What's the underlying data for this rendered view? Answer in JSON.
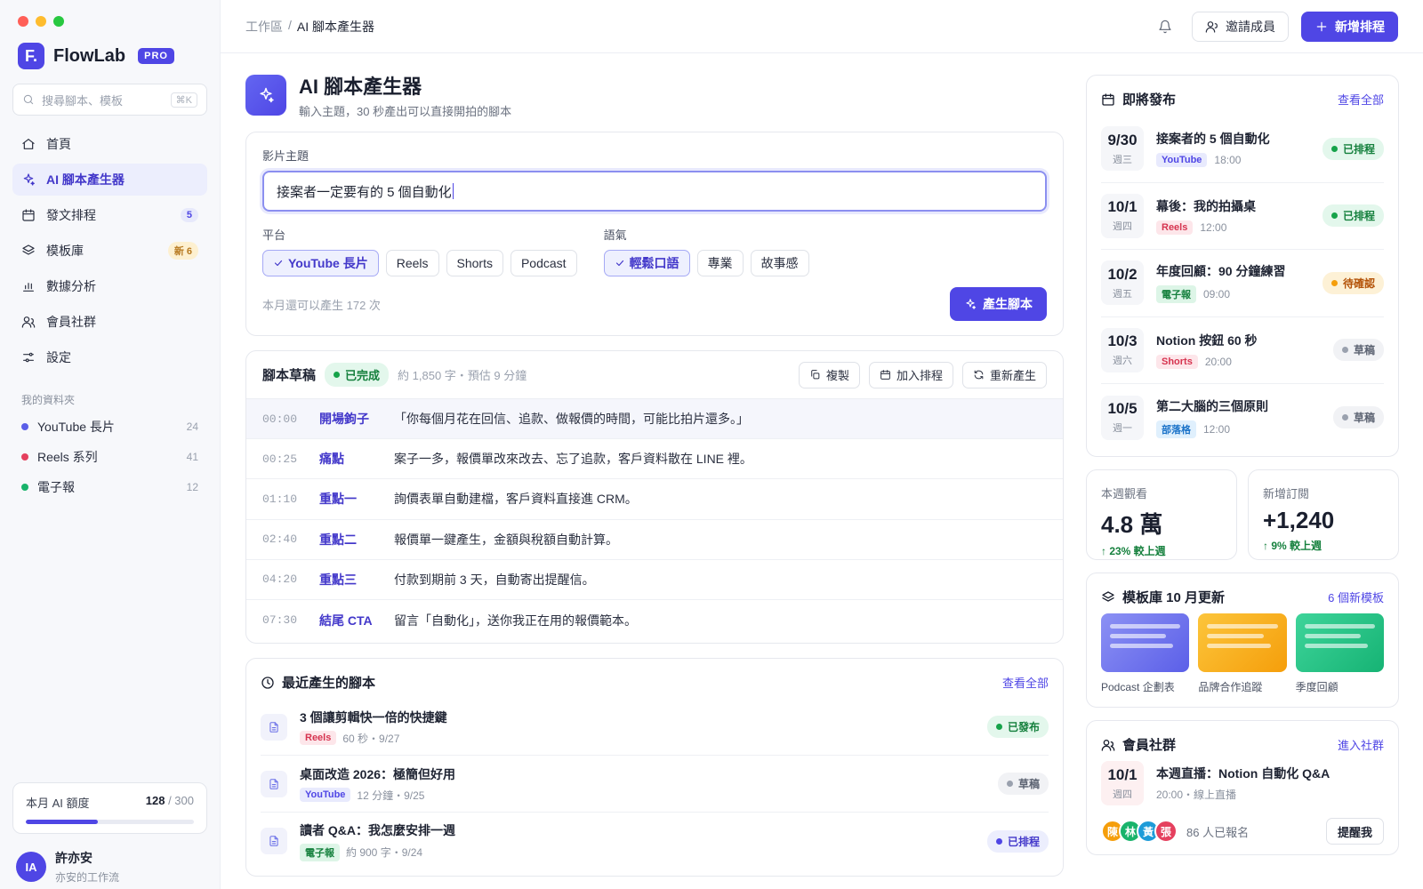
{
  "window": {
    "dots": [
      "#ff5f57",
      "#febc2e",
      "#28c840"
    ]
  },
  "brand": {
    "logo": "F.",
    "name": "FlowLab",
    "badge": "PRO"
  },
  "search": {
    "placeholder": "搜尋腳本、模板",
    "shortcut": "⌘K"
  },
  "nav": [
    {
      "label": "首頁",
      "icon": "home-icon"
    },
    {
      "label": "AI 腳本產生器",
      "icon": "sparkle-icon",
      "active": true
    },
    {
      "label": "發文排程",
      "icon": "calendar-icon",
      "count": "5"
    },
    {
      "label": "模板庫",
      "icon": "layers-icon",
      "badge": "新 6"
    },
    {
      "label": "數據分析",
      "icon": "chart-icon"
    },
    {
      "label": "會員社群",
      "icon": "users-icon"
    },
    {
      "label": "設定",
      "icon": "sliders-icon"
    }
  ],
  "folders": {
    "title": "我的資料夾",
    "items": [
      {
        "label": "YouTube 長片",
        "count": "24",
        "color": "#5b5fe8"
      },
      {
        "label": "Reels 系列",
        "count": "41",
        "color": "#e5405e"
      },
      {
        "label": "電子報",
        "count": "12",
        "color": "#19b36b"
      }
    ]
  },
  "quota": {
    "label": "本月 AI 額度",
    "used": "128",
    "total": "/ 300",
    "fraction": 0.427
  },
  "user": {
    "initials": "IA",
    "name": "許亦安",
    "subtitle": "亦安的工作流"
  },
  "topbar": {
    "crumb_root": "工作區",
    "crumb_sep": "/",
    "crumb_current": "AI 腳本產生器",
    "invite_label": "邀請成員",
    "new_label": "新增排程"
  },
  "page": {
    "title": "AI 腳本產生器",
    "subtitle": "輸入主題，30 秒產出可以直接開拍的腳本"
  },
  "generator": {
    "topic_label": "影片主題",
    "topic_value": "接案者一定要有的 5 個自動化",
    "platform_label": "平台",
    "platforms": [
      {
        "label": "YouTube 長片",
        "on": true
      },
      {
        "label": "Reels"
      },
      {
        "label": "Shorts"
      },
      {
        "label": "Podcast"
      }
    ],
    "tone_label": "語氣",
    "tones": [
      {
        "label": "輕鬆口語",
        "on": true
      },
      {
        "label": "專業"
      },
      {
        "label": "故事感"
      }
    ],
    "quota_note": "本月還可以產生 172 次",
    "generate_label": "產生腳本"
  },
  "draft": {
    "title": "腳本草稿",
    "status": "已完成",
    "meta": "約 1,850 字・預估 9 分鐘",
    "copy_label": "複製",
    "schedule_label": "加入排程",
    "regen_label": "重新產生",
    "lines": [
      {
        "time": "00:00",
        "section": "開場鉤子",
        "text": "「你每個月花在回信、追款、做報價的時間，可能比拍片還多。」"
      },
      {
        "time": "00:25",
        "section": "痛點",
        "text": "案子一多，報價單改來改去、忘了追款，客戶資料散在 LINE 裡。"
      },
      {
        "time": "01:10",
        "section": "重點一",
        "text": "詢價表單自動建檔，客戶資料直接進 CRM。"
      },
      {
        "time": "02:40",
        "section": "重點二",
        "text": "報價單一鍵產生，金額與稅額自動計算。"
      },
      {
        "time": "04:20",
        "section": "重點三",
        "text": "付款到期前 3 天，自動寄出提醒信。"
      },
      {
        "time": "07:30",
        "section": "結尾 CTA",
        "text": "留言「自動化」，送你我正在用的報價範本。"
      }
    ]
  },
  "recent": {
    "title": "最近產生的腳本",
    "link": "查看全部",
    "items": [
      {
        "title": "3 個讓剪輯快一倍的快捷鍵",
        "tag": "Reels",
        "tag_class": "reels",
        "meta": "60 秒・9/27",
        "status": "已發布",
        "status_class": "pub"
      },
      {
        "title": "桌面改造 2026：極簡但好用",
        "tag": "YouTube",
        "tag_class": "yt",
        "meta": "12 分鐘・9/25",
        "status": "草稿",
        "status_class": "draftp"
      },
      {
        "title": "讀者 Q&A：我怎麼安排一週",
        "tag": "電子報",
        "tag_class": "news",
        "meta": "約 900 字・9/24",
        "status": "已排程",
        "status_class": "sched"
      }
    ]
  },
  "upcoming": {
    "title": "即將發布",
    "link": "查看全部",
    "items": [
      {
        "date": "9/30",
        "weekday": "週三",
        "title": "接案者的 5 個自動化",
        "tag": "YouTube",
        "tag_class": "yt",
        "time": "18:00",
        "status": "已排程",
        "status_class": "pub"
      },
      {
        "date": "10/1",
        "weekday": "週四",
        "title": "幕後：我的拍攝桌",
        "tag": "Reels",
        "tag_class": "reels",
        "time": "12:00",
        "status": "已排程",
        "status_class": "pub"
      },
      {
        "date": "10/2",
        "weekday": "週五",
        "title": "年度回顧：90 分鐘練習",
        "tag": "電子報",
        "tag_class": "news",
        "time": "09:00",
        "status": "待確認",
        "status_class": "pend"
      },
      {
        "date": "10/3",
        "weekday": "週六",
        "title": "Notion 按鈕 60 秒",
        "tag": "Shorts",
        "tag_class": "shorts",
        "time": "20:00",
        "status": "草稿",
        "status_class": "draftp"
      },
      {
        "date": "10/5",
        "weekday": "週一",
        "title": "第二大腦的三個原則",
        "tag": "部落格",
        "tag_class": "blog",
        "time": "12:00",
        "status": "草稿",
        "status_class": "draftp"
      }
    ]
  },
  "stats": [
    {
      "label": "本週觀看",
      "value": "4.8 萬",
      "delta": "↑ 23% 較上週"
    },
    {
      "label": "新增訂閱",
      "value": "+1,240",
      "delta": "↑ 9% 較上週"
    }
  ],
  "templates": {
    "title": "模板庫 10 月更新",
    "link": "6 個新模板",
    "items": [
      {
        "name": "Podcast 企劃表",
        "from": "#8c91f4",
        "to": "#5b5fe8"
      },
      {
        "name": "品牌合作追蹤",
        "from": "#fcc53b",
        "to": "#f59e0b"
      },
      {
        "name": "季度回顧",
        "from": "#3ed49a",
        "to": "#16b374"
      }
    ]
  },
  "community": {
    "title": "會員社群",
    "link": "進入社群",
    "event_date": "10/1",
    "event_weekday": "週四",
    "event_title": "本週直播：Notion 自動化 Q&A",
    "event_meta": "20:00・線上直播",
    "attendees": [
      {
        "initial": "陳",
        "color": "#f59e0b"
      },
      {
        "initial": "林",
        "color": "#19b36b"
      },
      {
        "initial": "黃",
        "color": "#1d9bd8"
      },
      {
        "initial": "張",
        "color": "#e5405e"
      }
    ],
    "count": "86 人已報名",
    "remind_label": "提醒我"
  }
}
